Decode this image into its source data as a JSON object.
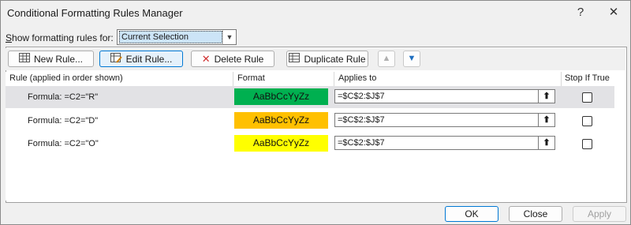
{
  "window": {
    "title": "Conditional Formatting Rules Manager",
    "help": "?",
    "close": "✕"
  },
  "show_rules": {
    "label_pre": "",
    "label_access": "S",
    "label_post": "how formatting rules for:",
    "value": "Current Selection"
  },
  "toolbar": {
    "new_rule": "New Rule...",
    "edit_rule": "Edit Rule...",
    "delete_rule": "Delete Rule",
    "duplicate_rule": "Duplicate Rule",
    "move_up": "▲",
    "move_down": "▼"
  },
  "headers": {
    "rule": "Rule (applied in order shown)",
    "format": "Format",
    "applies_to": "Applies to",
    "stop_if_true": "Stop If True"
  },
  "rules": [
    {
      "formula": "Formula: =C2=\"R\"",
      "preview": "AaBbCcYyZz",
      "color": "#00b050",
      "applies": "=$C$2:$J$7"
    },
    {
      "formula": "Formula: =C2=\"D\"",
      "preview": "AaBbCcYyZz",
      "color": "#ffc000",
      "applies": "=$C$2:$J$7"
    },
    {
      "formula": "Formula: =C2=\"O\"",
      "preview": "AaBbCcYyZz",
      "color": "#ffff00",
      "applies": "=$C$2:$J$7"
    }
  ],
  "footer": {
    "ok": "OK",
    "close": "Close",
    "apply": "Apply"
  }
}
